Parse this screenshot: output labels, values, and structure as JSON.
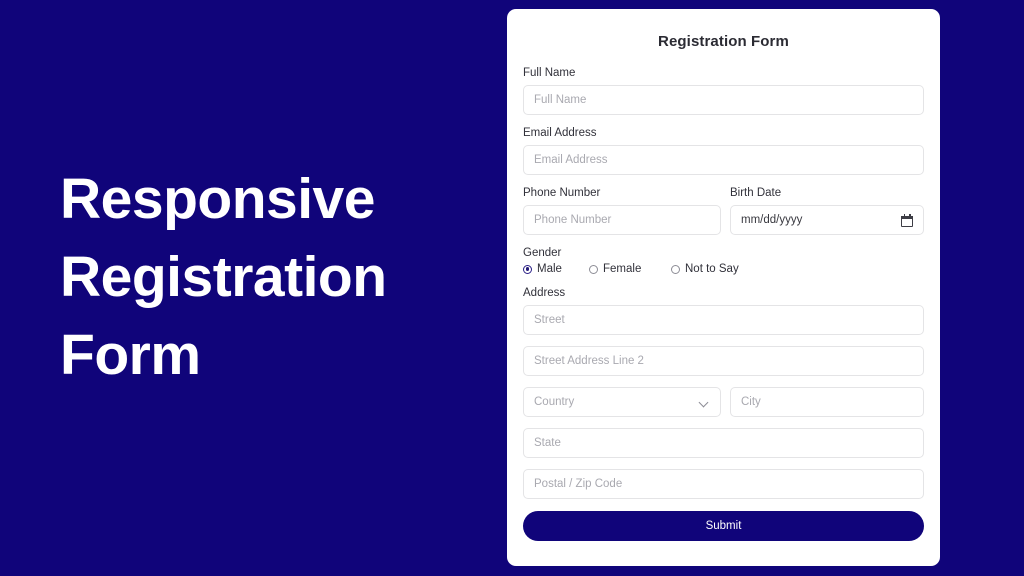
{
  "page": {
    "background_color": "#10047A",
    "accent_color": "#10047A"
  },
  "hero": {
    "lines": [
      "Responsive",
      "Registration",
      "Form"
    ]
  },
  "form": {
    "title": "Registration Form",
    "fields": {
      "full_name": {
        "label": "Full Name",
        "placeholder": "Full Name",
        "value": ""
      },
      "email": {
        "label": "Email Address",
        "placeholder": "Email Address",
        "value": ""
      },
      "phone": {
        "label": "Phone Number",
        "placeholder": "Phone Number",
        "value": ""
      },
      "birth_date": {
        "label": "Birth Date",
        "placeholder": "mm/dd/yyyy",
        "value": "mm/dd/yyyy"
      },
      "street": {
        "placeholder": "Street",
        "value": ""
      },
      "street2": {
        "placeholder": "Street Address Line 2",
        "value": ""
      },
      "country": {
        "placeholder": "Country",
        "value": "Country"
      },
      "city": {
        "placeholder": "City",
        "value": ""
      },
      "state": {
        "placeholder": "State",
        "value": ""
      },
      "postal": {
        "placeholder": "Postal / Zip Code",
        "value": ""
      }
    },
    "gender": {
      "label": "Gender",
      "options": [
        {
          "label": "Male",
          "selected": true
        },
        {
          "label": "Female",
          "selected": false
        },
        {
          "label": "Not to Say",
          "selected": false
        }
      ]
    },
    "address": {
      "label": "Address"
    },
    "submit": {
      "label": "Submit"
    }
  }
}
